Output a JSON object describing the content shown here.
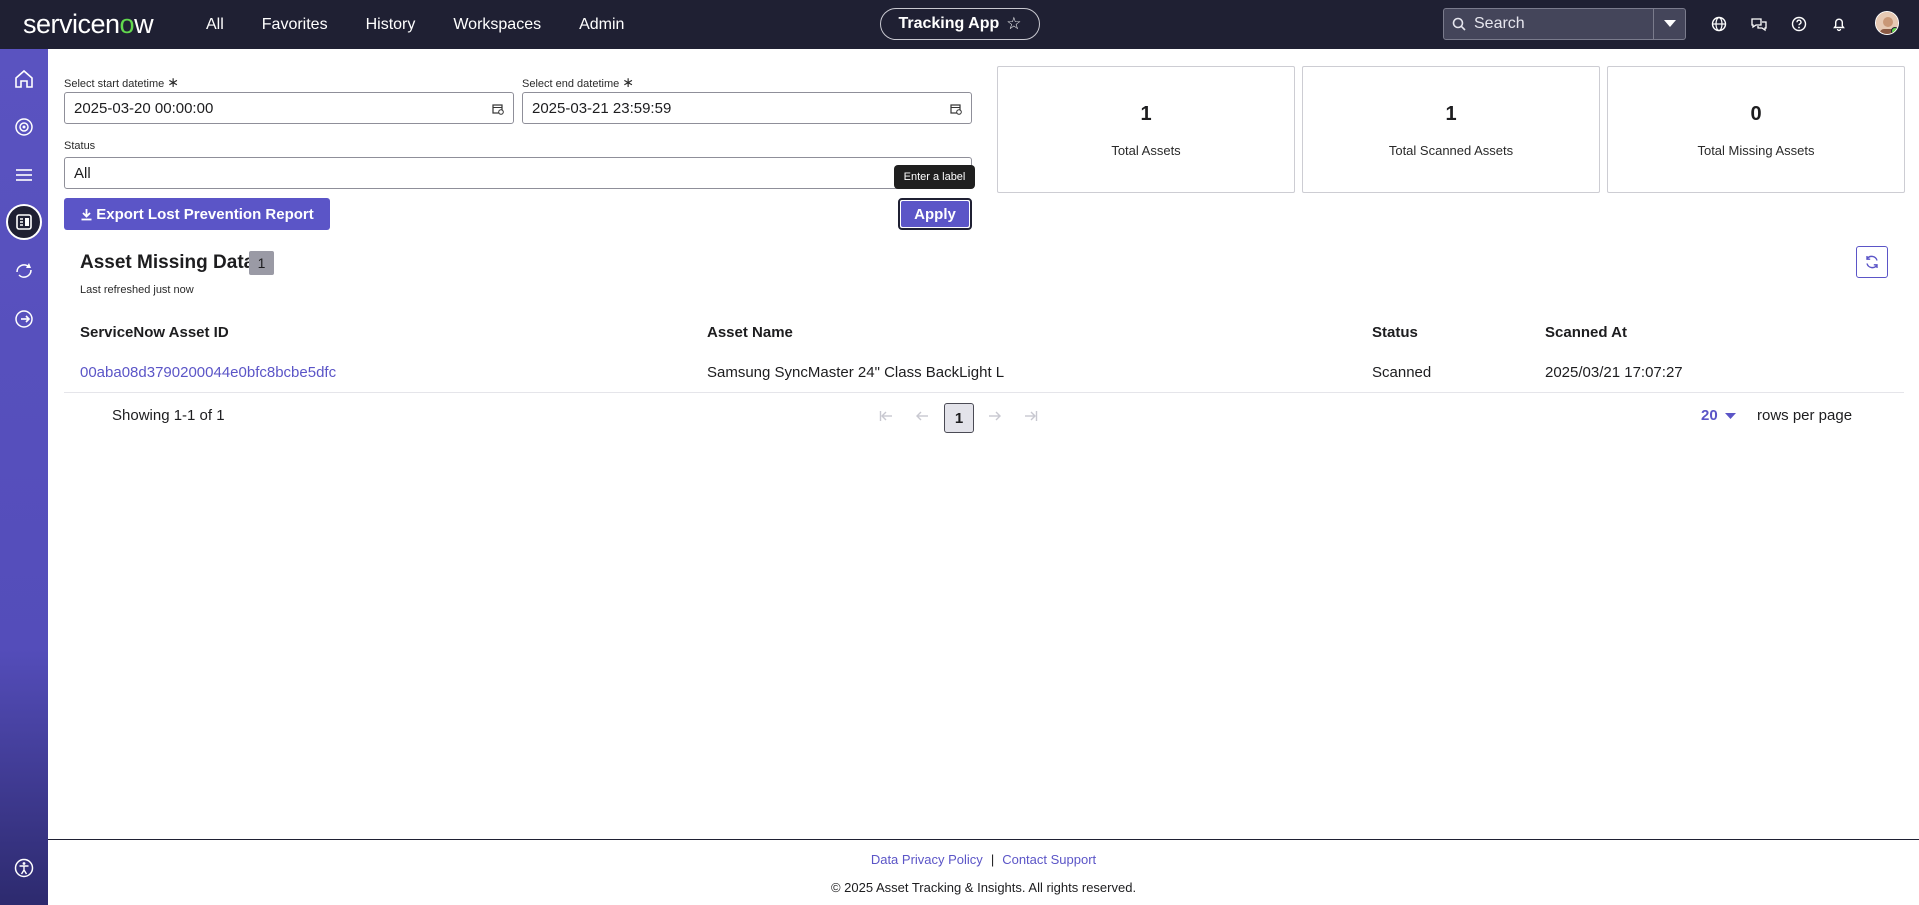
{
  "brand": {
    "logo_text_a": "servicen",
    "logo_text_o": "o",
    "logo_text_b": "w"
  },
  "nav": {
    "items": [
      "All",
      "Favorites",
      "History",
      "Workspaces",
      "Admin"
    ]
  },
  "app_pill": {
    "label": "Tracking App",
    "star": "☆"
  },
  "search": {
    "placeholder": "Search"
  },
  "filters": {
    "start_label": "Select start datetime",
    "start_value": "2025-03-20 00:00:00",
    "end_label": "Select end datetime",
    "end_value": "2025-03-21 23:59:59",
    "required_mark": "∗",
    "status_label": "Status",
    "status_value": "All",
    "export_label": "Export Lost Prevention Report",
    "apply_label": "Apply",
    "tooltip": "Enter a label"
  },
  "stats": [
    {
      "value": "1",
      "label": "Total Assets"
    },
    {
      "value": "1",
      "label": "Total Scanned Assets"
    },
    {
      "value": "0",
      "label": "Total Missing Assets"
    }
  ],
  "section": {
    "title": "Asset Missing Data",
    "count": "1",
    "subtitle": "Last refreshed just now"
  },
  "table": {
    "columns": [
      "ServiceNow Asset ID",
      "Asset Name",
      "Status",
      "Scanned At"
    ],
    "rows": [
      [
        "00aba08d3790200044e0bfc8bcbe5dfc",
        "Samsung SyncMaster 24\" Class BackLight L",
        "Scanned",
        "2025/03/21 17:07:27"
      ]
    ]
  },
  "pager": {
    "showing": "Showing 1-1 of 1",
    "page": "1",
    "page_size": "20",
    "rows_per_page": "rows per page"
  },
  "footer": {
    "privacy": "Data Privacy Policy",
    "separator": "|",
    "support": "Contact Support",
    "copyright": "© 2025 Asset Tracking & Insights. All rights reserved."
  },
  "colors": {
    "accent": "#5b55c7",
    "topbar": "#1f2033",
    "sidebar": "#5a53c0"
  }
}
